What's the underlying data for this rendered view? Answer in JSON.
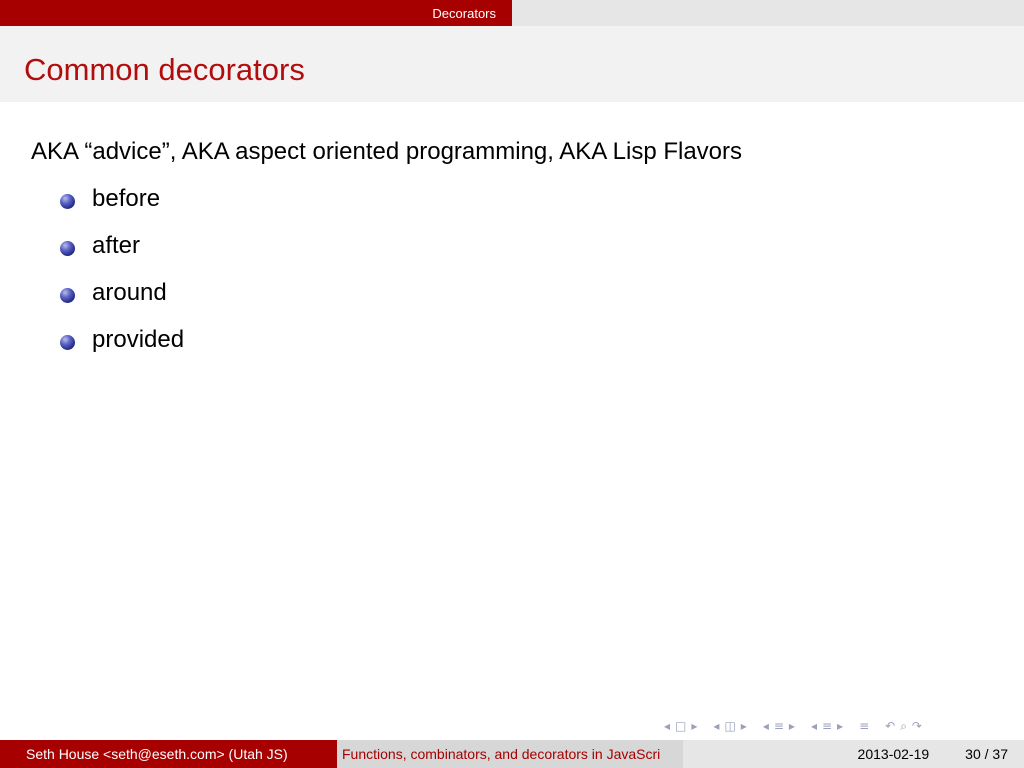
{
  "header": {
    "section": "Decorators"
  },
  "frame": {
    "title": "Common decorators"
  },
  "body": {
    "lead": "AKA “advice”, AKA aspect oriented programming, AKA Lisp Flavors",
    "bullets": [
      "before",
      "after",
      "around",
      "provided"
    ]
  },
  "footer": {
    "author": "Seth House <seth@eseth.com>  (Utah JS)",
    "title": "Functions, combinators, and decorators in JavaScri",
    "date": "2013-02-19",
    "page": "30 / 37"
  },
  "nav": {
    "icons": [
      "nav-prev-slide-icon",
      "nav-slide-box-icon",
      "nav-next-slide-icon",
      "nav-prev-frame-icon",
      "nav-frame-box-icon",
      "nav-next-frame-icon",
      "nav-prev-subsection-icon",
      "nav-subsection-icon",
      "nav-next-subsection-icon",
      "nav-prev-section-icon",
      "nav-section-icon",
      "nav-next-section-icon",
      "nav-align-icon",
      "nav-back-icon",
      "nav-search-icon",
      "nav-forward-icon"
    ]
  },
  "colors": {
    "accent": "#a60000",
    "title": "#b20d0d",
    "bullet": "#2a3190"
  }
}
